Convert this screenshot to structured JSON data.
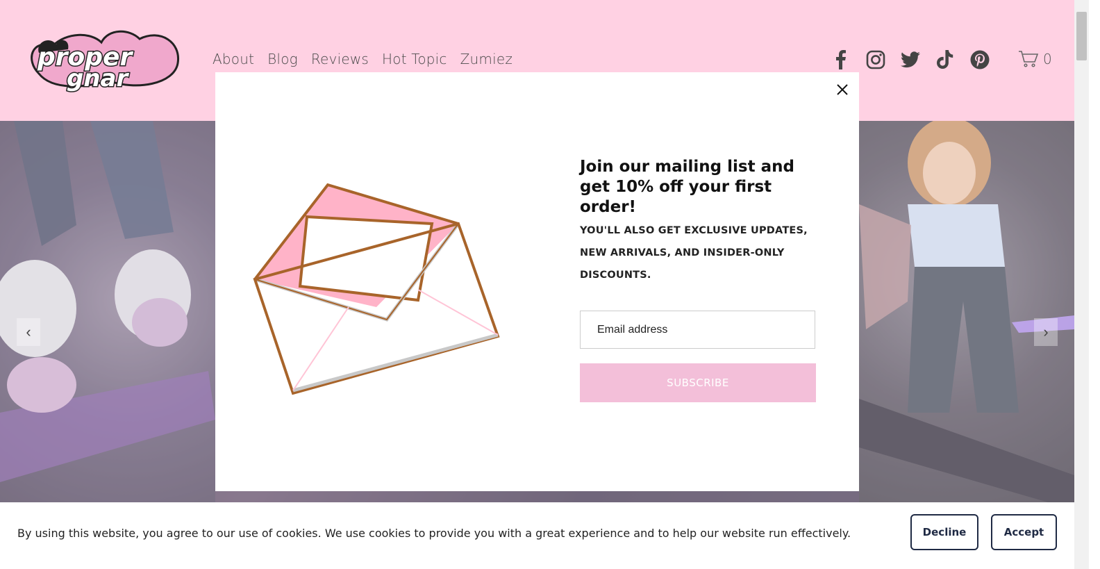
{
  "brand": {
    "logo_text": "Proper Gnar"
  },
  "nav": {
    "items": [
      "About",
      "Blog",
      "Reviews",
      "Hot Topic",
      "Zumiez"
    ]
  },
  "social": [
    "facebook-icon",
    "instagram-icon",
    "twitter-icon",
    "tiktok-icon",
    "pinterest-icon"
  ],
  "cart": {
    "count": "0"
  },
  "hero": {
    "prev": "‹",
    "next": "›"
  },
  "modal": {
    "close": "✕",
    "title": "Join our mailing list and get 10% off your first order!",
    "subtitle": "YOU'LL ALSO GET EXCLUSIVE UPDATES, NEW ARRIVALS, AND INSIDER-ONLY DISCOUNTS.",
    "email_placeholder": "Email address",
    "subscribe_label": "SUBSCRIBE"
  },
  "cookie": {
    "text": "By using this website, you agree to our use of cookies. We use cookies to provide you with a great experience and to help our website run effectively.",
    "decline": "Decline",
    "accept": "Accept"
  },
  "colors": {
    "header_bg": "#ffd1e3",
    "accent": "#f3bfd9",
    "button_border": "#1f2a44"
  }
}
